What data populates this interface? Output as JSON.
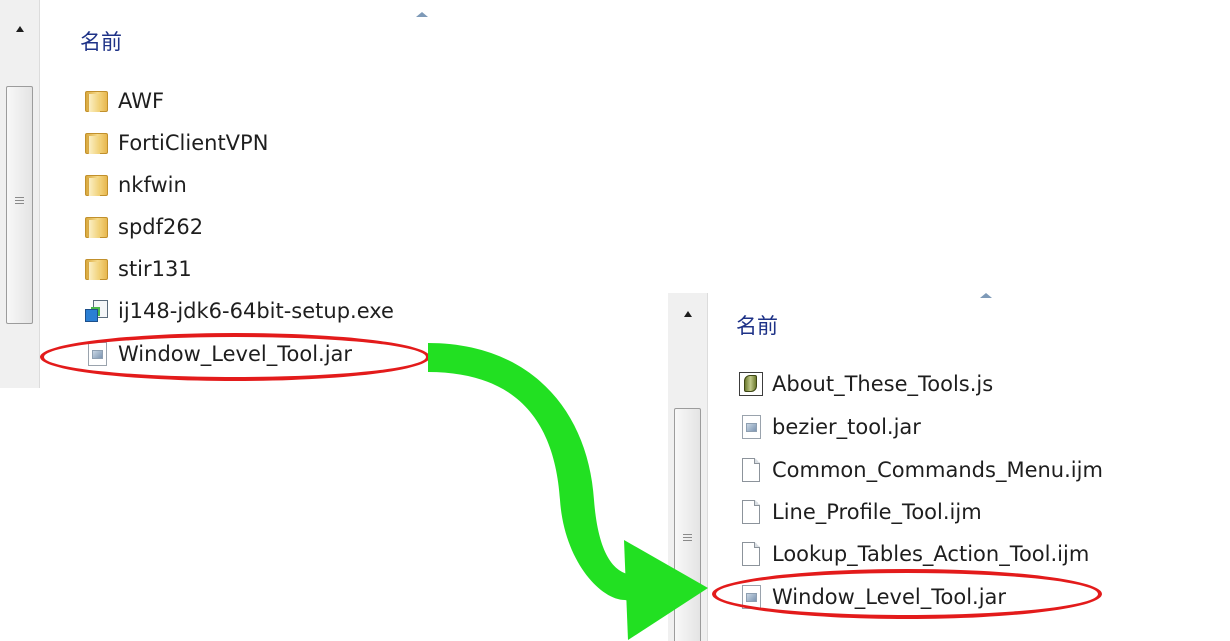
{
  "left_pane": {
    "column_header": "名前",
    "items": [
      {
        "icon": "folder-icon",
        "name": "AWF"
      },
      {
        "icon": "folder-icon",
        "name": "FortiClientVPN"
      },
      {
        "icon": "folder-icon",
        "name": "nkfwin"
      },
      {
        "icon": "folder-icon",
        "name": "spdf262"
      },
      {
        "icon": "folder-icon",
        "name": "stir131"
      },
      {
        "icon": "installer-icon",
        "name": "ij148-jdk6-64bit-setup.exe"
      },
      {
        "icon": "jar-icon",
        "name": "Window_Level_Tool.jar"
      }
    ]
  },
  "right_pane": {
    "column_header": "名前",
    "items": [
      {
        "icon": "script-icon",
        "name": "About_These_Tools.js"
      },
      {
        "icon": "jar-icon",
        "name": "bezier_tool.jar"
      },
      {
        "icon": "doc-icon",
        "name": "Common_Commands_Menu.ijm"
      },
      {
        "icon": "doc-icon",
        "name": "Line_Profile_Tool.ijm"
      },
      {
        "icon": "doc-icon",
        "name": "Lookup_Tables_Action_Tool.ijm"
      },
      {
        "icon": "jar-icon",
        "name": "Window_Level_Tool.jar"
      }
    ]
  },
  "annotations": {
    "highlight_color": "#e31b1b",
    "arrow_color": "#22e022"
  }
}
